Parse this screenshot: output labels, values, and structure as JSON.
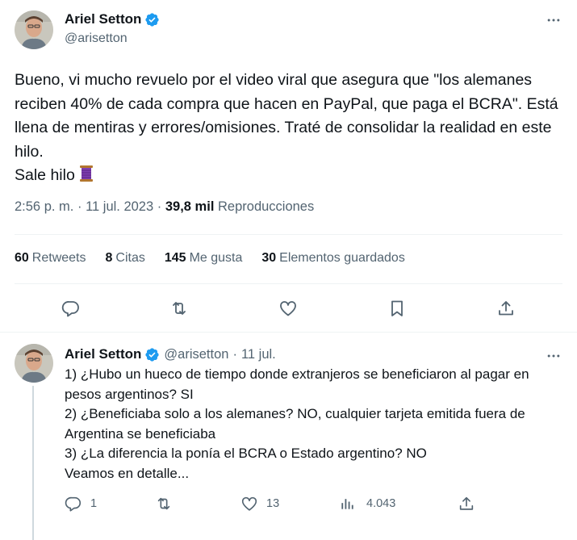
{
  "main_tweet": {
    "author": {
      "display_name": "Ariel Setton",
      "handle": "@arisetton",
      "verified": true,
      "verified_color": "#1d9bf0"
    },
    "text": "Bueno, vi mucho revuelo por el video viral que asegura que \"los alemanes reciben 40% de cada compra que hacen en PayPal, que paga el BCRA\". Está llena de mentiras y errores/omisiones. Traté de consolidar la realidad en este hilo.\nSale hilo",
    "emoji_icon": "spool-of-thread-icon",
    "time": "2:56 p. m.",
    "sep1": "·",
    "date": "11 jul. 2023",
    "sep2": "·",
    "views_count": "39,8 mil",
    "views_label": "Reproducciones",
    "stats": {
      "retweets": {
        "num": "60",
        "label": "Retweets"
      },
      "quotes": {
        "num": "8",
        "label": "Citas"
      },
      "likes": {
        "num": "145",
        "label": "Me gusta"
      },
      "bookmarks": {
        "num": "30",
        "label": "Elementos guardados"
      }
    },
    "actions": [
      "reply-icon",
      "retweet-icon",
      "like-icon",
      "bookmark-icon",
      "share-icon"
    ]
  },
  "reply_tweet": {
    "author": {
      "display_name": "Ariel Setton",
      "handle": "@arisetton",
      "dot": "·",
      "date": "11 jul."
    },
    "text": "1) ¿Hubo un hueco de tiempo donde extranjeros se beneficiaron al pagar en pesos argentinos? SI\n2) ¿Beneficiaba solo a los alemanes? NO, cualquier tarjeta emitida fuera de Argentina se beneficiaba\n3) ¿La diferencia la ponía el BCRA o Estado argentino? NO\nVeamos en detalle...",
    "actions": {
      "replies": "1",
      "retweets": "",
      "likes": "13",
      "views": "4.043"
    }
  },
  "colors": {
    "text_primary": "#0f1419",
    "text_secondary": "#536471",
    "divider": "#eff3f4",
    "thread_line": "#cfd9de",
    "verified": "#1d9bf0"
  }
}
